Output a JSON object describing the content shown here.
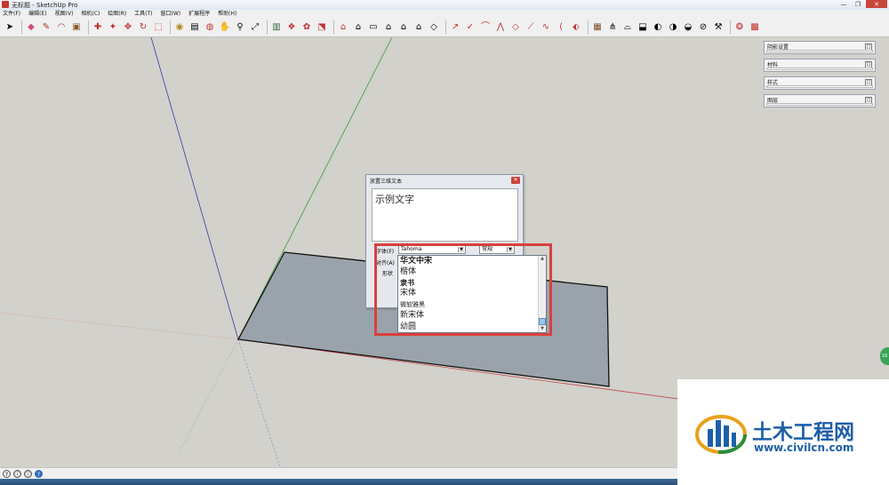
{
  "window": {
    "title": "无标题 - SketchUp Pro",
    "controls": {
      "minimize": "—",
      "maximize": "❐",
      "close": "✕"
    }
  },
  "menu": [
    "文件(F)",
    "编辑(E)",
    "视图(V)",
    "相机(C)",
    "绘图(R)",
    "工具(T)",
    "窗口(W)",
    "扩展程序",
    "帮助(H)"
  ],
  "toolbar_icons": [
    "select-icon",
    "eraser-icon",
    "pencil-icon",
    "arc-icon",
    "rectangle-icon",
    "push-pull-icon",
    "follow-me-icon",
    "move-icon",
    "rotate-icon",
    "scale-icon",
    "tape-measure-icon",
    "text-icon",
    "orbit-icon",
    "pan-icon",
    "zoom-icon",
    "zoom-extents-icon",
    "warehouse-icon",
    "component-icon",
    "paint-icon",
    "section-icon",
    "camera-icon",
    "iso-view-icon",
    "top-view-icon",
    "front-view-icon",
    "right-view-icon",
    "back-view-icon",
    "left-view-icon",
    "xray-icon",
    "wireframe-icon",
    "hidden-line-icon",
    "shaded-icon",
    "textured-icon",
    "monochrome-icon",
    "sandbox-icon",
    "smoove-icon",
    "stamp-icon",
    "drape-icon",
    "add-detail-icon",
    "flip-edge-icon",
    "outer-shell-icon",
    "intersect-icon",
    "union-icon",
    "subtract-icon",
    "trim-icon",
    "split-icon",
    "ruby-icon",
    "extension-icon"
  ],
  "trays": [
    {
      "label": "阴影设置",
      "pin": "□"
    },
    {
      "label": "材料",
      "pin": "□"
    },
    {
      "label": "样式",
      "pin": "□"
    },
    {
      "label": "图层",
      "pin": "□"
    }
  ],
  "dialog": {
    "title": "放置三维文本",
    "close": "✕",
    "text_value": "示例文字",
    "font_label": "字体(F)",
    "align_label": "对齐(A)",
    "shape_label": "形状",
    "font_value": "Tahoma",
    "style_value": "常规",
    "font_options": [
      "华文中宋",
      "楷体",
      "隶书",
      "宋体",
      "微软雅黑",
      "新宋体",
      "幼圆"
    ]
  },
  "scroll": {
    "up": "▲",
    "down": "▼"
  },
  "watermark": {
    "name": "土木工程网",
    "url": "www.civilcn.com"
  },
  "side_tab": "16",
  "status_icons": [
    "?",
    "ⓘ",
    "ⓘ",
    "?"
  ],
  "colors": {
    "axis_blue": "#3a3aa0",
    "axis_green": "#3a9a3a",
    "axis_red": "#c24848",
    "face": "#9aa2ab",
    "highlight": "#d9403c"
  }
}
